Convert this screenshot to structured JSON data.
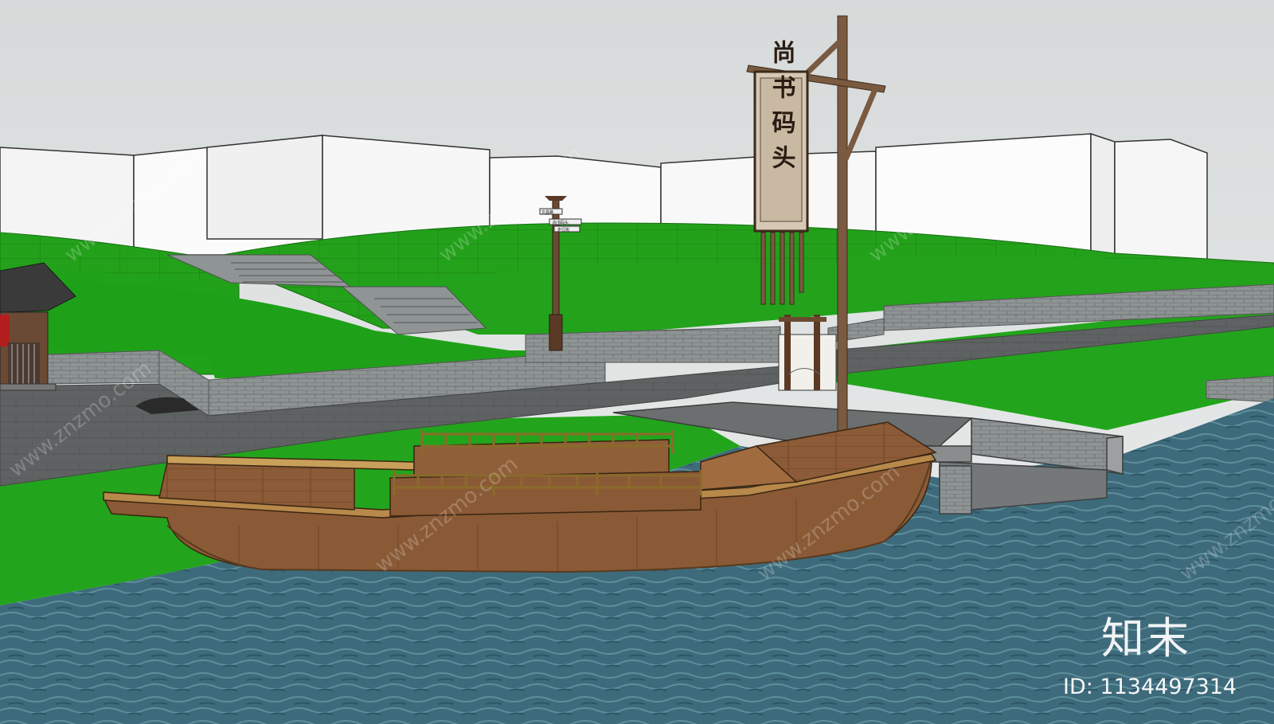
{
  "scene": {
    "banner_text": "尚书码头",
    "signpost_labels": [
      "文昌路",
      "尚书码头",
      "步行街"
    ]
  },
  "watermark": {
    "text": "www.znzmo.com",
    "logo": "知末",
    "id_label": "ID: 1134497314"
  },
  "colors": {
    "sky": "#e3e5e5",
    "grass": "#2aa61d",
    "water": "#3d6a7a",
    "wood": "#8a5a36",
    "stone": "#8f9393"
  }
}
